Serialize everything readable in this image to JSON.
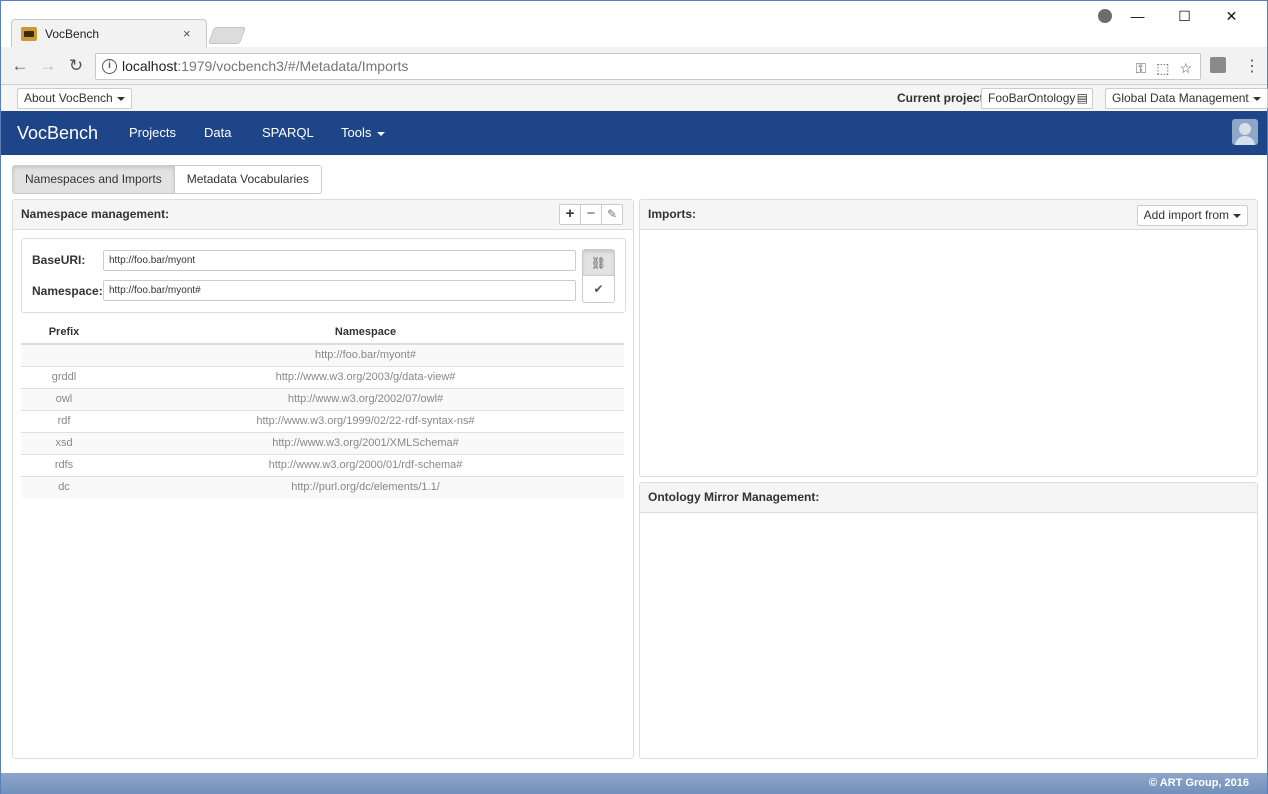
{
  "browser": {
    "tab_title": "VocBench",
    "tab_close": "×",
    "url_host": "localhost",
    "url_path": ":1979/vocbench3/#/Metadata/Imports",
    "controls": {
      "minimize": "—",
      "maximize": "☐",
      "close": "✕"
    },
    "omni_icons": {
      "key": "⚿",
      "translate": "⬚",
      "star": "☆"
    },
    "back": "←",
    "forward": "→",
    "reload": "↻",
    "menu": "⋮"
  },
  "appbar": {
    "about_label": "About VocBench",
    "current_project_label": "Current project:",
    "project_name": "FooBarOntology",
    "project_icon": "▤",
    "global_data_label": "Global Data Management"
  },
  "navbar": {
    "brand": "VocBench",
    "items": [
      {
        "label": "Projects"
      },
      {
        "label": "Data"
      },
      {
        "label": "SPARQL"
      },
      {
        "label": "Tools"
      }
    ]
  },
  "subtabs": [
    {
      "label": "Namespaces and Imports",
      "active": true
    },
    {
      "label": "Metadata Vocabularies",
      "active": false
    }
  ],
  "namespace_panel": {
    "title": "Namespace management:",
    "add": "+",
    "remove": "−",
    "edit": "✎",
    "baseuri_label": "BaseURI:",
    "baseuri_value": "http://foo.bar/myont",
    "namespace_label": "Namespace:",
    "namespace_value": "http://foo.bar/myont#",
    "link_icon": "⛓",
    "check_icon": "✔",
    "table": {
      "headers": {
        "prefix": "Prefix",
        "namespace": "Namespace"
      },
      "rows": [
        {
          "prefix": "",
          "namespace": "http://foo.bar/myont#"
        },
        {
          "prefix": "grddl",
          "namespace": "http://www.w3.org/2003/g/data-view#"
        },
        {
          "prefix": "owl",
          "namespace": "http://www.w3.org/2002/07/owl#"
        },
        {
          "prefix": "rdf",
          "namespace": "http://www.w3.org/1999/02/22-rdf-syntax-ns#"
        },
        {
          "prefix": "xsd",
          "namespace": "http://www.w3.org/2001/XMLSchema#"
        },
        {
          "prefix": "rdfs",
          "namespace": "http://www.w3.org/2000/01/rdf-schema#"
        },
        {
          "prefix": "dc",
          "namespace": "http://purl.org/dc/elements/1.1/"
        }
      ]
    }
  },
  "imports_panel": {
    "title": "Imports:",
    "add_import_label": "Add import from"
  },
  "mirror_panel": {
    "title": "Ontology Mirror Management:"
  },
  "footer": {
    "text": "© ART Group, 2016"
  }
}
